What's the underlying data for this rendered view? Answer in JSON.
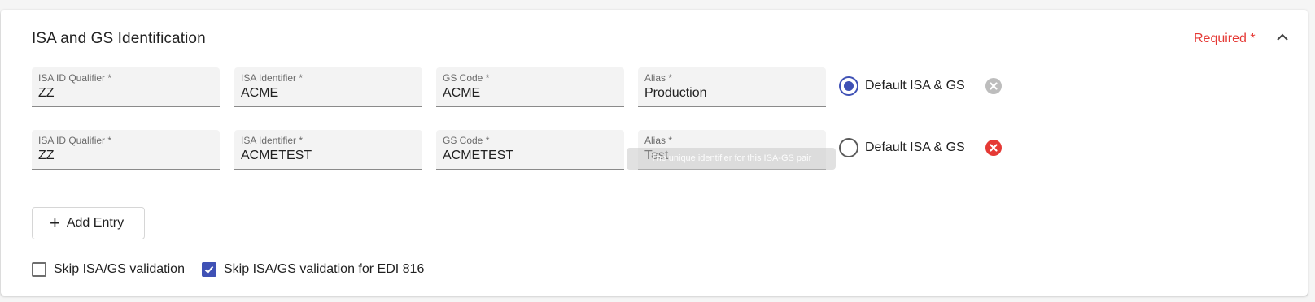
{
  "section": {
    "title": "ISA and GS Identification",
    "required_label": "Required *",
    "collapse_icon": "chevron-up-icon"
  },
  "entries": [
    {
      "isa_id_qualifier": {
        "label": "ISA ID Qualifier *",
        "value": "ZZ"
      },
      "isa_identifier": {
        "label": "ISA Identifier *",
        "value": "ACME"
      },
      "gs_code": {
        "label": "GS Code *",
        "value": "ACME"
      },
      "alias": {
        "label": "Alias *",
        "value": "Production"
      },
      "default": {
        "label": "Default ISA & GS",
        "selected": true
      },
      "remove": {
        "icon": "remove-circle-icon",
        "enabled": false
      }
    },
    {
      "isa_id_qualifier": {
        "label": "ISA ID Qualifier *",
        "value": "ZZ"
      },
      "isa_identifier": {
        "label": "ISA Identifier *",
        "value": "ACMETEST"
      },
      "gs_code": {
        "label": "GS Code *",
        "value": "ACMETEST"
      },
      "alias": {
        "label": "Alias *",
        "value": "Test"
      },
      "default": {
        "label": "Default ISA & GS",
        "selected": false
      },
      "remove": {
        "icon": "remove-circle-icon",
        "enabled": true
      }
    }
  ],
  "tooltip": {
    "text": "The unique identifier for this ISA-GS pair"
  },
  "add_entry": {
    "label": "Add Entry",
    "icon": "plus-icon"
  },
  "options": {
    "skip_validation": {
      "label": "Skip ISA/GS validation",
      "checked": false
    },
    "skip_validation_edi816": {
      "label": "Skip ISA/GS validation for EDI 816",
      "checked": true
    }
  },
  "colors": {
    "accent": "#3f51b5",
    "required": "#e53935",
    "remove_active": "#e53935",
    "remove_disabled": "#bdbdbd"
  }
}
